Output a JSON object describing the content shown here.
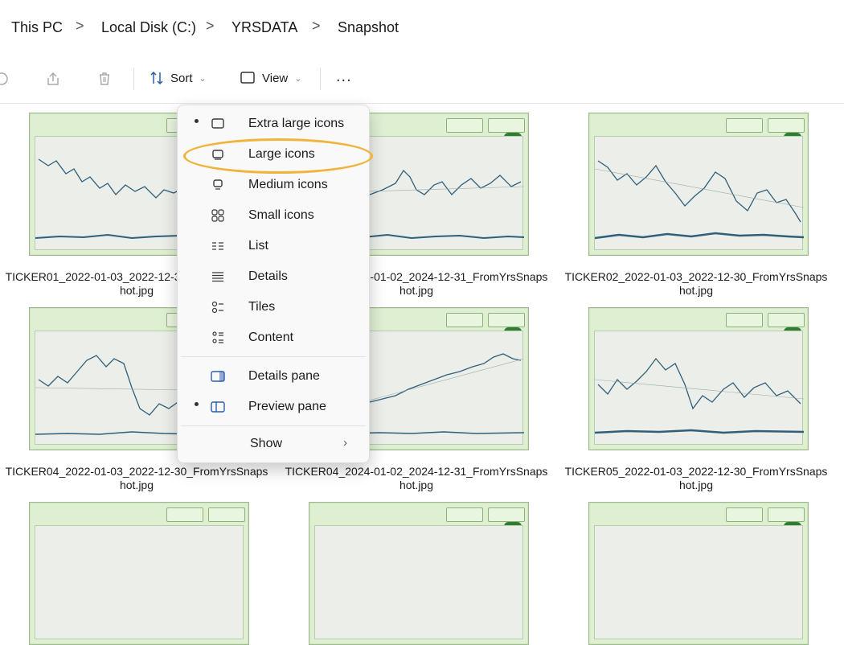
{
  "breadcrumb": {
    "items": [
      "This PC",
      "Local Disk (C:)",
      "YRSDATA",
      "Snapshot"
    ],
    "separator": ">"
  },
  "toolbar": {
    "sort_label": "Sort",
    "view_label": "View",
    "more_label": "..."
  },
  "view_menu": {
    "items": [
      {
        "label": "Extra large icons",
        "icon": "extra-large-icons-icon",
        "selected": true
      },
      {
        "label": "Large icons",
        "icon": "large-icons-icon",
        "selected": false,
        "circled": true
      },
      {
        "label": "Medium icons",
        "icon": "medium-icons-icon",
        "selected": false
      },
      {
        "label": "Small icons",
        "icon": "small-icons-icon",
        "selected": false
      },
      {
        "label": "List",
        "icon": "list-icon",
        "selected": false
      },
      {
        "label": "Details",
        "icon": "details-icon",
        "selected": false
      },
      {
        "label": "Tiles",
        "icon": "tiles-icon",
        "selected": false
      },
      {
        "label": "Content",
        "icon": "content-icon",
        "selected": false
      },
      {
        "label": "Details pane",
        "icon": "details-pane-icon",
        "selected": false
      },
      {
        "label": "Preview pane",
        "icon": "preview-pane-icon",
        "selected": true
      },
      {
        "label": "Show",
        "icon": "",
        "submenu": true
      }
    ],
    "highlight_color": "#f0b43c"
  },
  "files": [
    {
      "line1": "TICKER01_2022-01-03_2022-12-30_FromYrsSnaps",
      "line2": "hot.jpg"
    },
    {
      "line1": "TICKER03_2024-01-02_2024-12-31_FromYrsSnaps",
      "line2": "hot.jpg"
    },
    {
      "line1": "TICKER02_2022-01-03_2022-12-30_FromYrsSnaps",
      "line2": "hot.jpg"
    },
    {
      "line1": "TICKER04_2022-01-03_2022-12-30_FromYrsSnaps",
      "line2": "hot.jpg"
    },
    {
      "line1": "TICKER04_2024-01-02_2024-12-31_FromYrsSnaps",
      "line2": "hot.jpg"
    },
    {
      "line1": "TICKER05_2022-01-03_2022-12-30_FromYrsSnaps",
      "line2": "hot.jpg"
    }
  ],
  "colors": {
    "thumbnail_bg": "#dff0d2",
    "line": "#2f5f7a",
    "accent": "#2e7d32"
  }
}
